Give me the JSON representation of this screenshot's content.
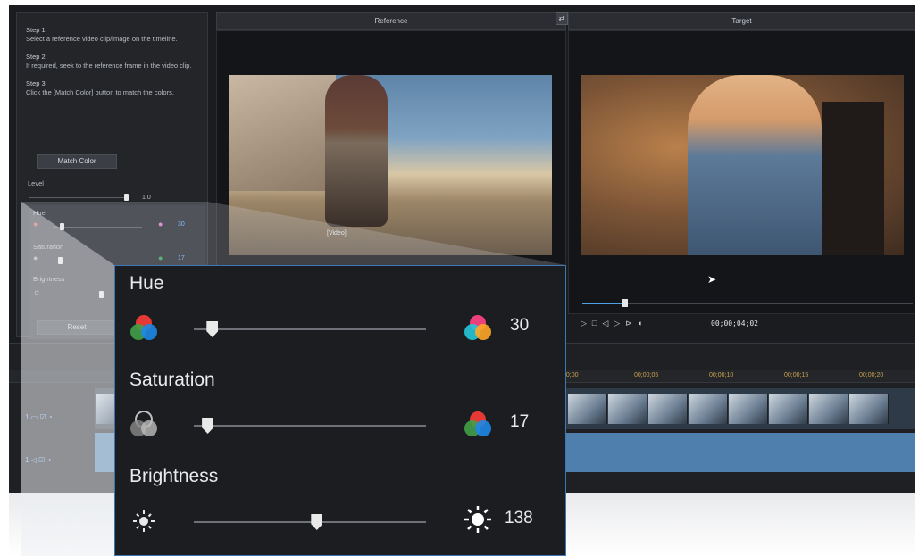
{
  "steps": {
    "step1_title": "Step 1:",
    "step1_text": "Select a reference video clip/image on the timeline.",
    "step2_title": "Step 2:",
    "step2_text": "If required, seek to the reference frame in the video clip.",
    "step3_title": "Step 3:",
    "step3_text": "Click the [Match Color] button to match the colors.",
    "match_color_label": "Match Color",
    "level_label": "Level",
    "level_value": "1.0",
    "reset_label": "Reset"
  },
  "mini_adjust": {
    "hue_label": "Hue",
    "hue_value": "30",
    "saturation_label": "Saturation",
    "saturation_value": "17",
    "brightness_label": "Brightness"
  },
  "preview": {
    "reference_title": "Reference",
    "target_title": "Target",
    "caption": "[Video]",
    "timecode": "00;00;04;02",
    "scrub_progress": 0.13
  },
  "timeline": {
    "ruler": [
      "00;00",
      "00;00;05",
      "00;00;10",
      "00;00;15",
      "00;00;20"
    ],
    "track1_id": "1",
    "track2_id": "1"
  },
  "zoom": {
    "hue_label": "Hue",
    "hue_value": "30",
    "hue_level": 0.08,
    "saturation_label": "Saturation",
    "saturation_value": "17",
    "saturation_level": 0.06,
    "brightness_label": "Brightness",
    "brightness_value": "138",
    "brightness_level": 0.53
  },
  "colors": {
    "accent": "#4d9fe6",
    "panel": "#1c1d20",
    "border": "#3c78b5"
  }
}
